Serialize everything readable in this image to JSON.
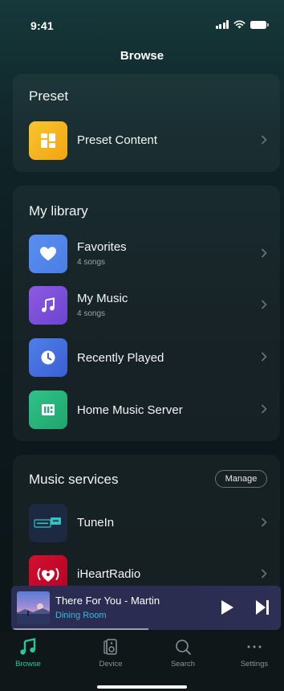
{
  "status_bar": {
    "time": "9:41"
  },
  "header": {
    "title": "Browse"
  },
  "preset": {
    "title": "Preset",
    "items": [
      {
        "label": "Preset Content",
        "icon": "grid-icon",
        "color": "#f5b81c"
      }
    ]
  },
  "library": {
    "title": "My library",
    "items": [
      {
        "label": "Favorites",
        "sub": "4 songs",
        "icon": "heart-icon",
        "color": "#3f7fe0"
      },
      {
        "label": "My Music",
        "sub": "4 songs",
        "icon": "music-note-icon",
        "color": "#7c4fd6"
      },
      {
        "label": "Recently Played",
        "sub": "",
        "icon": "clock-icon",
        "color": "#3d63d6"
      },
      {
        "label": "Home Music Server",
        "sub": "",
        "icon": "server-icon",
        "color": "#26b27a"
      }
    ]
  },
  "services": {
    "title": "Music services",
    "manage_label": "Manage",
    "items": [
      {
        "label": "TuneIn",
        "icon": "tunein-logo-icon",
        "color": "#1e2a40"
      },
      {
        "label": "iHeartRadio",
        "icon": "iheartradio-logo-icon",
        "color": "#c6002b"
      }
    ]
  },
  "now_playing": {
    "title": "There For You - Martin",
    "room": "Dining Room",
    "progress": 0.51
  },
  "tabs": [
    {
      "label": "Browse",
      "icon": "music-note-icon",
      "active": true
    },
    {
      "label": "Device",
      "icon": "speaker-icon",
      "active": false
    },
    {
      "label": "Search",
      "icon": "search-icon",
      "active": false
    },
    {
      "label": "Settings",
      "icon": "more-icon",
      "active": false
    }
  ],
  "colors": {
    "accent": "#2cc49a",
    "room": "#3fb6d8"
  }
}
